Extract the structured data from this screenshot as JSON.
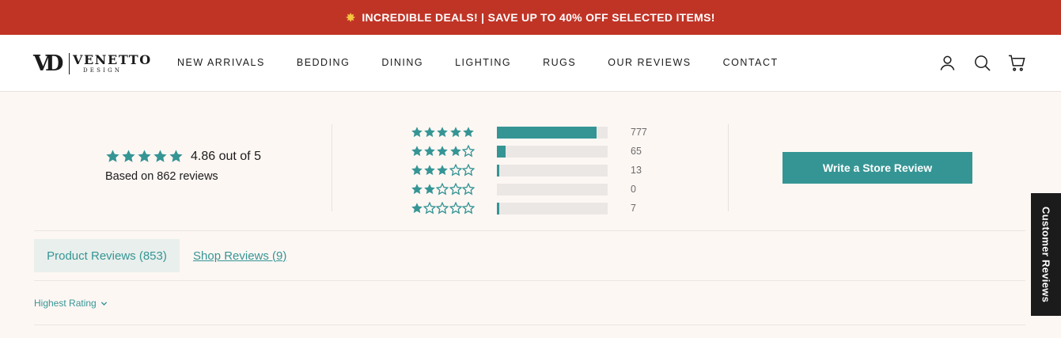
{
  "announcement": {
    "icon": "sparkle-icon",
    "text": "INCREDIBLE DEALS! | SAVE UP TO 40% OFF SELECTED ITEMS!"
  },
  "logo": {
    "monogram": "VD",
    "wordmark": "VENETTO",
    "subtitle": "DESIGN"
  },
  "nav": {
    "items": [
      "NEW ARRIVALS",
      "BEDDING",
      "DINING",
      "LIGHTING",
      "RUGS",
      "OUR REVIEWS",
      "CONTACT"
    ]
  },
  "header_icons": [
    "account-icon",
    "search-icon",
    "cart-icon"
  ],
  "summary": {
    "average": 4.86,
    "stars_filled": 5,
    "average_text": "4.86 out of 5",
    "based_text": "Based on 862 reviews"
  },
  "histogram": [
    {
      "stars": 5,
      "count": 777,
      "count_label": "777"
    },
    {
      "stars": 4,
      "count": 65,
      "count_label": "65"
    },
    {
      "stars": 3,
      "count": 13,
      "count_label": "13"
    },
    {
      "stars": 2,
      "count": 0,
      "count_label": "0"
    },
    {
      "stars": 1,
      "count": 7,
      "count_label": "7"
    }
  ],
  "write_review": {
    "label": "Write a Store Review"
  },
  "tabs": {
    "active": "Product Reviews (853)",
    "other": "Shop Reviews (9)"
  },
  "sort": {
    "label": "Highest Rating",
    "icon": "chevron-down-icon"
  },
  "side_tab": {
    "label": "Customer Reviews"
  },
  "colors": {
    "accent": "#359594",
    "banner": "#c03426",
    "background": "#fdf7f4",
    "track": "#ebe7e5"
  }
}
